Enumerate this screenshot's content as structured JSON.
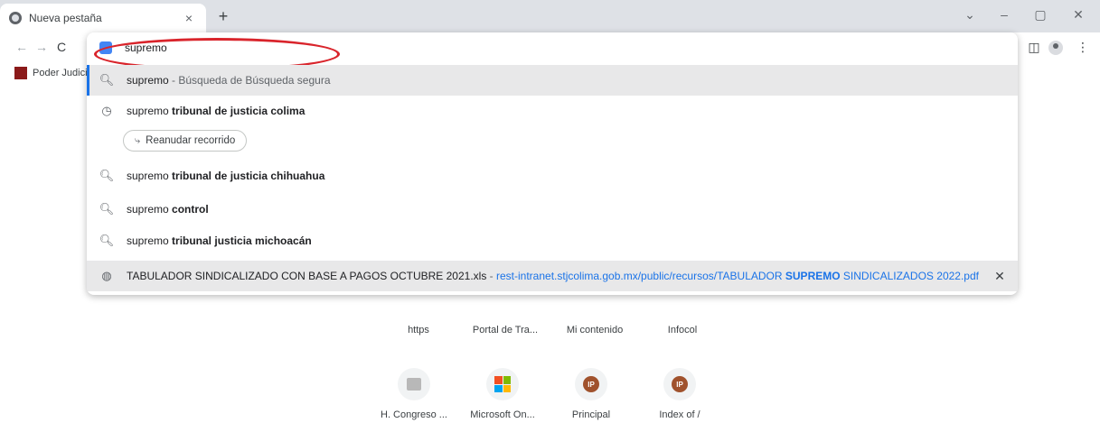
{
  "tab": {
    "title": "Nueva pestaña",
    "close": "×",
    "new_tab": "+"
  },
  "window": {
    "dropdown": "⌄",
    "minimize": "–",
    "restore": "▢",
    "close": "✕"
  },
  "nav": {
    "back": "←",
    "forward": "→",
    "reload": "C"
  },
  "toolbar": {
    "side_panel": "◫",
    "menu": "⋮"
  },
  "bookmarks": {
    "item_label": "Poder Judicial"
  },
  "omnibox": {
    "value": "supremo",
    "suggestions": [
      {
        "query": "supremo",
        "separator": " - ",
        "detail": "Búsqueda de Búsqueda segura"
      },
      {
        "query": "supremo",
        "completion": " tribunal de justicia colima"
      },
      {
        "query": "supremo",
        "completion": " tribunal de justicia chihuahua"
      },
      {
        "query": "supremo",
        "completion": " control"
      },
      {
        "query": "supremo",
        "completion": " tribunal justicia michoacán"
      }
    ],
    "resume_chip": "Reanudar recorrido",
    "document": {
      "title": "TABULADOR SINDICALIZADO CON BASE A PAGOS OCTUBRE 2021.xls",
      "separator": " - ",
      "url_start": "rest-intranet.stjcolima.gob.mx/public/recursos/TABULADOR ",
      "url_bold": "SUPREMO",
      "url_end": " SINDICALIZADOS 2022.pdf",
      "remove": "✕"
    }
  },
  "shortcuts": {
    "row1": [
      "https",
      "Portal de Tra...",
      "Mi contenido",
      "Infocol"
    ],
    "row2": [
      {
        "label": "H. Congreso ...",
        "icon": "congress-icon"
      },
      {
        "label": "Microsoft On...",
        "icon": "microsoft-icon"
      },
      {
        "label": "Principal",
        "icon": "ip-icon",
        "badge": "IP"
      },
      {
        "label": "Index of /",
        "icon": "ip-icon",
        "badge": "IP"
      }
    ]
  },
  "colors": {
    "accent": "#1a73e8",
    "annotation": "#d9242b",
    "tab_strip": "#dee1e6",
    "selected_row": "#e8e8e9"
  }
}
